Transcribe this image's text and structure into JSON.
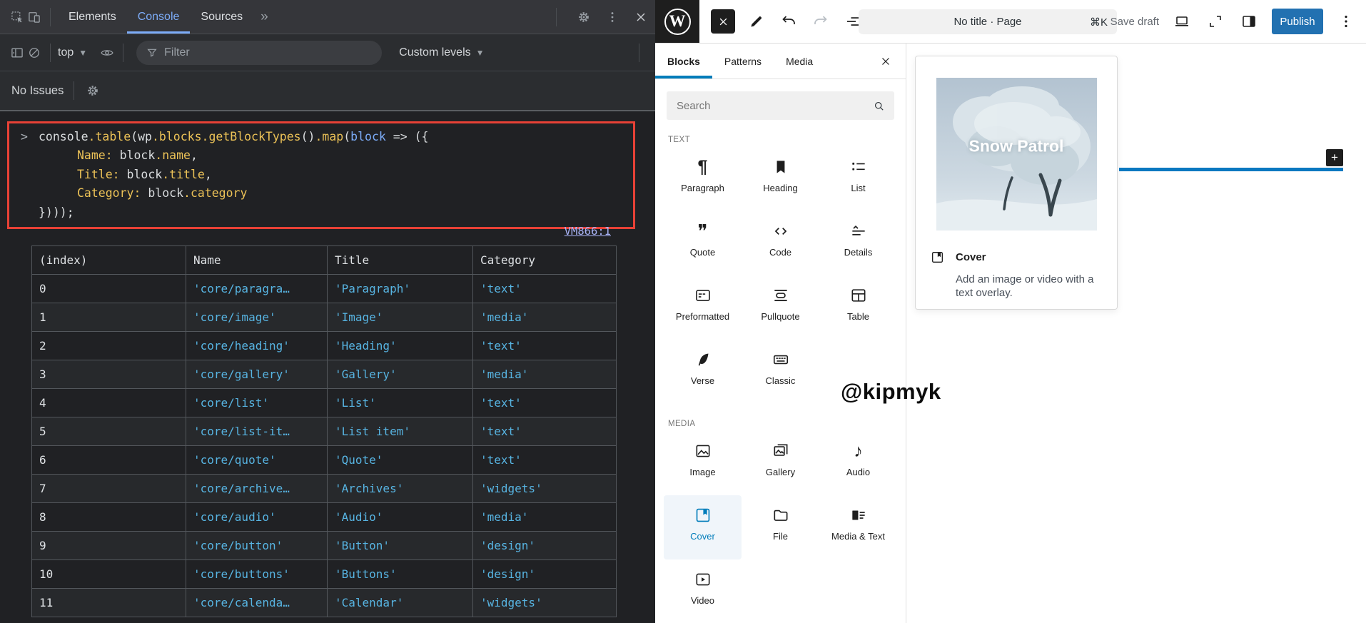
{
  "theme": {
    "devtools_bg": "#202124",
    "devtools_accent": "#7cacf8",
    "highlight_red": "#e74136",
    "code_yellow": "#ecc257",
    "code_param_blue": "#7cacf8",
    "string_blue": "#57b4e2",
    "source_link_color": "#a8b2f5",
    "wp_accent": "#007cba",
    "publish_blue": "#2271b1",
    "insertion_blue": "#0a78c0"
  },
  "devtools": {
    "tab_strip": {
      "tabs": [
        {
          "label": "Elements",
          "active": false
        },
        {
          "label": "Console",
          "active": true
        },
        {
          "label": "Sources",
          "active": false
        }
      ],
      "more_tabs": "»"
    },
    "toolbar": {
      "context_selector": "top",
      "filter_placeholder": "Filter",
      "levels_selector": "Custom levels"
    },
    "issues_bar": {
      "label": "No Issues"
    },
    "console": {
      "prompt": ">",
      "code_lines": [
        {
          "indent": 0,
          "prompt": true,
          "segments": [
            [
              "console",
              "d"
            ],
            [
              ".table",
              "y"
            ],
            [
              "(",
              "d"
            ],
            [
              "wp",
              "d"
            ],
            [
              ".blocks",
              "y"
            ],
            [
              ".getBlockTypes",
              "y"
            ],
            [
              "()",
              "d"
            ],
            [
              ".map",
              "y"
            ],
            [
              "(",
              "d"
            ],
            [
              "block",
              "b"
            ],
            [
              " => ({",
              "d"
            ]
          ]
        },
        {
          "indent": 1,
          "segments": [
            [
              "Name:",
              "y"
            ],
            [
              " block",
              "d"
            ],
            [
              ".name",
              "y"
            ],
            [
              ",",
              "d"
            ]
          ]
        },
        {
          "indent": 1,
          "segments": [
            [
              "Title:",
              "y"
            ],
            [
              " block",
              "d"
            ],
            [
              ".title",
              "y"
            ],
            [
              ",",
              "d"
            ]
          ]
        },
        {
          "indent": 1,
          "segments": [
            [
              "Category:",
              "y"
            ],
            [
              " block",
              "d"
            ],
            [
              ".category",
              "y"
            ]
          ]
        },
        {
          "indent": 0,
          "segments": [
            [
              "})));",
              "d"
            ]
          ]
        }
      ],
      "source_link": "VM866:1",
      "table": {
        "columns": [
          "(index)",
          "Name",
          "Title",
          "Category"
        ],
        "rows": [
          [
            "0",
            "'core/paragra…",
            "'Paragraph'",
            "'text'"
          ],
          [
            "1",
            "'core/image'",
            "'Image'",
            "'media'"
          ],
          [
            "2",
            "'core/heading'",
            "'Heading'",
            "'text'"
          ],
          [
            "3",
            "'core/gallery'",
            "'Gallery'",
            "'media'"
          ],
          [
            "4",
            "'core/list'",
            "'List'",
            "'text'"
          ],
          [
            "5",
            "'core/list-it…",
            "'List item'",
            "'text'"
          ],
          [
            "6",
            "'core/quote'",
            "'Quote'",
            "'text'"
          ],
          [
            "7",
            "'core/archive…",
            "'Archives'",
            "'widgets'"
          ],
          [
            "8",
            "'core/audio'",
            "'Audio'",
            "'media'"
          ],
          [
            "9",
            "'core/button'",
            "'Button'",
            "'design'"
          ],
          [
            "10",
            "'core/buttons'",
            "'Buttons'",
            "'design'"
          ],
          [
            "11",
            "'core/calenda…",
            "'Calendar'",
            "'widgets'"
          ]
        ]
      }
    }
  },
  "wp": {
    "topbar": {
      "document_title": "No title · Page",
      "shortcut": "⌘K",
      "save_draft": "Save draft",
      "publish": "Publish"
    },
    "inserter": {
      "tabs": [
        {
          "label": "Blocks",
          "active": true
        },
        {
          "label": "Patterns",
          "active": false
        },
        {
          "label": "Media",
          "active": false
        }
      ],
      "search_placeholder": "Search",
      "sections": [
        {
          "label": "TEXT",
          "items": [
            {
              "label": "Paragraph",
              "icon": "paragraph"
            },
            {
              "label": "Heading",
              "icon": "heading"
            },
            {
              "label": "List",
              "icon": "list"
            },
            {
              "label": "Quote",
              "icon": "quote"
            },
            {
              "label": "Code",
              "icon": "code"
            },
            {
              "label": "Details",
              "icon": "details"
            },
            {
              "label": "Preformatted",
              "icon": "preformatted"
            },
            {
              "label": "Pullquote",
              "icon": "pullquote"
            },
            {
              "label": "Table",
              "icon": "table"
            },
            {
              "label": "Verse",
              "icon": "verse"
            },
            {
              "label": "Classic",
              "icon": "classic"
            }
          ]
        },
        {
          "label": "MEDIA",
          "items": [
            {
              "label": "Image",
              "icon": "image"
            },
            {
              "label": "Gallery",
              "icon": "gallery"
            },
            {
              "label": "Audio",
              "icon": "audio"
            },
            {
              "label": "Cover",
              "icon": "cover",
              "selected": true
            },
            {
              "label": "File",
              "icon": "file"
            },
            {
              "label": "Media & Text",
              "icon": "media-text"
            },
            {
              "label": "Video",
              "icon": "video"
            }
          ]
        }
      ]
    },
    "preview": {
      "image_title": "Snow Patrol",
      "block_title": "Cover",
      "description": "Add an image or video with a text overlay."
    },
    "watermark": "@kipmyk"
  }
}
